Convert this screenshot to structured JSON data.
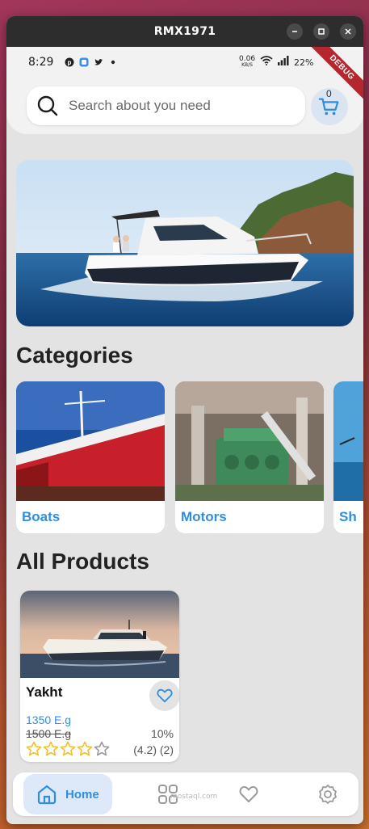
{
  "window": {
    "title": "RMX1971"
  },
  "status": {
    "time": "8:29",
    "speed_value": "0.06",
    "speed_unit": "KB/S",
    "battery": "22%",
    "debug_banner": "DEBUG"
  },
  "search": {
    "placeholder": "Search about you need"
  },
  "cart": {
    "count": "0"
  },
  "sections": {
    "categories": "Categories",
    "all_products": "All Products"
  },
  "categories": [
    {
      "label": "Boats"
    },
    {
      "label": "Motors"
    },
    {
      "label": "Sh"
    }
  ],
  "products": [
    {
      "name": "Yakht",
      "price": "1350 E.g",
      "old_price": "1500 E.g",
      "discount": "10%",
      "rating_text": "(4.2) (2)",
      "stars_filled": 4,
      "stars_total": 5
    }
  ],
  "nav": {
    "home": "Home",
    "watermark": "mostaql.com"
  },
  "colors": {
    "accent": "#2f8ee0",
    "star": "#f2c02c",
    "titlebar": "#2d2d2d"
  },
  "icons": [
    "search-icon",
    "cart-icon",
    "heart-icon",
    "star-icon",
    "home-icon",
    "grid-icon",
    "settings-icon"
  ]
}
